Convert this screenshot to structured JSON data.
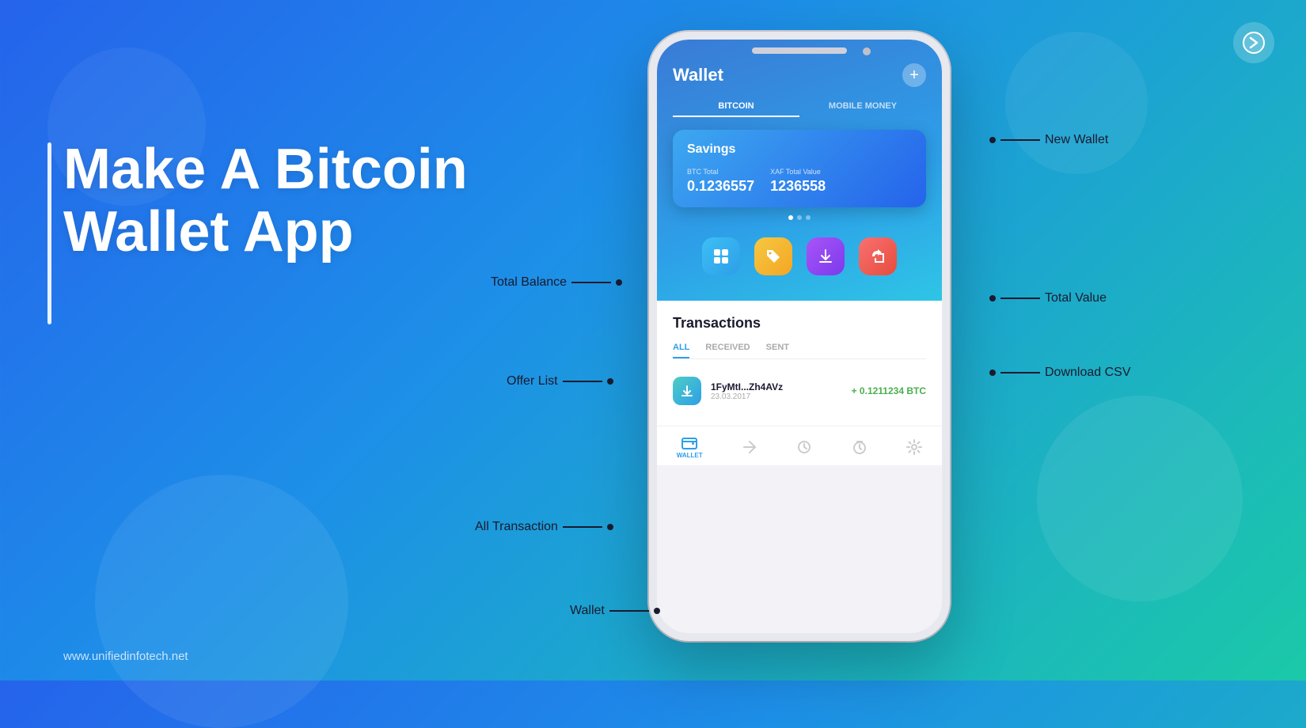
{
  "background": {
    "gradient_start": "#2563eb",
    "gradient_end": "#1bc9a8"
  },
  "logo": {
    "symbol": "⚡"
  },
  "heading": {
    "line1": "Make A Bitcoin",
    "line2": "Wallet App"
  },
  "footer": {
    "url": "www.unifiedinfotech.net"
  },
  "phone": {
    "header": {
      "title": "Wallet",
      "add_btn": "+"
    },
    "tabs": [
      {
        "label": "BITCOIN",
        "active": true
      },
      {
        "label": "MOBILE MONEY",
        "active": false
      }
    ],
    "savings_card": {
      "title": "Savings",
      "btc_label": "BTC Total",
      "btc_value": "0.1236557",
      "xaf_label": "XAF Total Value",
      "xaf_value": "1236558"
    },
    "action_icons": [
      {
        "name": "offer-list-icon",
        "bg": "#3dbff5",
        "symbol": "🛒"
      },
      {
        "name": "tag-icon",
        "bg": "#f5a623",
        "symbol": "🏷️"
      },
      {
        "name": "download-icon",
        "bg": "#9b59b6",
        "symbol": "⬇"
      },
      {
        "name": "share-icon",
        "bg": "#e74c3c",
        "symbol": "↗"
      }
    ],
    "transactions": {
      "title": "Transactions",
      "tabs": [
        {
          "label": "ALL",
          "active": true
        },
        {
          "label": "RECEIVED",
          "active": false
        },
        {
          "label": "SENT",
          "active": false
        }
      ],
      "rows": [
        {
          "address": "1FyMtI...Zh4AVz",
          "date": "23.03.2017",
          "amount": "+ 0.1211234 BTC"
        }
      ]
    },
    "bottom_nav": [
      {
        "label": "WALLET",
        "active": true,
        "symbol": "💳"
      },
      {
        "label": "",
        "active": false,
        "symbol": "↗"
      },
      {
        "label": "",
        "active": false,
        "symbol": "🕐"
      },
      {
        "label": "",
        "active": false,
        "symbol": "⏱"
      },
      {
        "label": "",
        "active": false,
        "symbol": "⚙"
      }
    ]
  },
  "annotations": {
    "new_wallet": "New Wallet",
    "total_balance": "Total Balance",
    "total_value": "Total Value",
    "offer_list": "Offer List",
    "download_csv": "Download CSV",
    "all_transaction": "All Transaction",
    "wallet": "Wallet"
  }
}
